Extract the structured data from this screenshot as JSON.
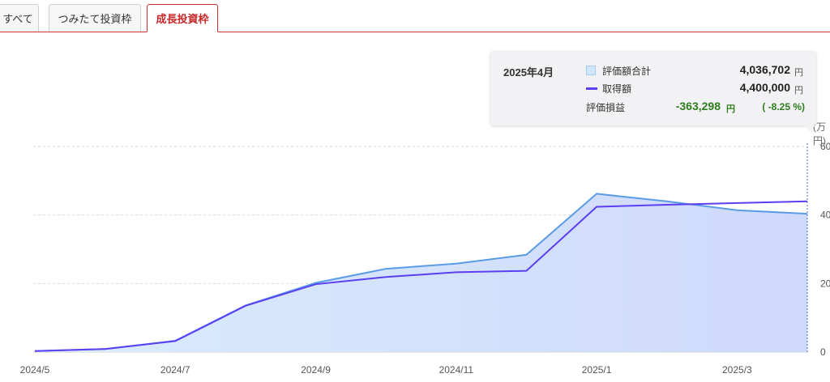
{
  "tabs": [
    {
      "label": "すべて",
      "active": false
    },
    {
      "label": "つみたて投資枠",
      "active": false
    },
    {
      "label": "成長投資枠",
      "active": true
    }
  ],
  "colors": {
    "accent": "#d32f2f",
    "area_fill": "#cfe6fb",
    "area_line": "#5a9be6",
    "cost_line": "#5b3ff0",
    "loss": "#2e7d1e"
  },
  "tooltip": {
    "date": "2025年4月",
    "rows": [
      {
        "label": "評価額合計",
        "value": "4,036,702",
        "unit": "円"
      },
      {
        "label": "取得額",
        "value": "4,400,000",
        "unit": "円"
      },
      {
        "label": "評価損益",
        "value": "-363,298",
        "unit": "円",
        "percent": "( -8.25 %)"
      }
    ]
  },
  "y_unit_label": "(万円)",
  "chart_data": {
    "type": "area",
    "x": [
      "2024/5",
      "2024/6",
      "2024/7",
      "2024/8",
      "2024/9",
      "2024/10",
      "2024/11",
      "2024/12",
      "2025/1",
      "2025/2",
      "2025/3",
      "2025/4"
    ],
    "xticks": [
      "2024/5",
      "2024/7",
      "2024/9",
      "2024/11",
      "2025/1",
      "2025/3"
    ],
    "yticks": [
      0,
      200,
      400,
      600
    ],
    "ytick_labels": [
      "0",
      "20",
      "40",
      "60"
    ],
    "ylim": [
      0,
      600
    ],
    "grid": true,
    "series": [
      {
        "name": "評価額合計",
        "type": "area",
        "values": [
          3,
          9,
          33,
          136,
          202,
          243,
          258,
          284,
          462,
          440,
          414,
          403.67
        ]
      },
      {
        "name": "取得額",
        "type": "line",
        "values": [
          3,
          9,
          32,
          135,
          198,
          219,
          233,
          237,
          424,
          430,
          435,
          440
        ]
      }
    ]
  }
}
